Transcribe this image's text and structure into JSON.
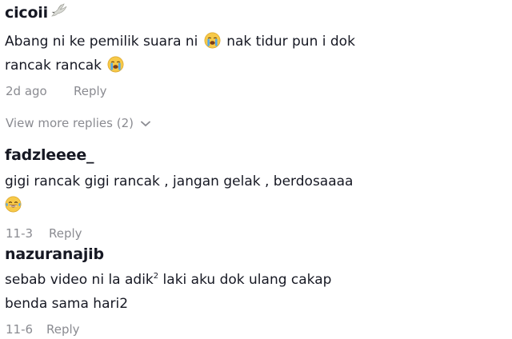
{
  "comments": [
    {
      "username": "cicoii",
      "text_line1_a": "Abang ni ke pemilik suara ni",
      "text_line1_b": "nak tidur pun i dok",
      "text_line2": "rancak rancak",
      "date": "2d ago",
      "reply_label": "Reply",
      "view_more_label": "View more replies (2)"
    },
    {
      "username": "fadzleeee_",
      "text_line1": "gigi rancak gigi rancak , jangan gelak , berdosaaaa",
      "date": "11-3",
      "reply_label": "Reply"
    },
    {
      "username": "nazuranajib",
      "text_line1_a": "sebab video ni la adik",
      "text_line1_sup": "2",
      "text_line1_b": " laki aku dok ulang cakap",
      "text_line2": "benda sama hari2",
      "date": "11-6",
      "reply_label": "Reply"
    }
  ],
  "colors": {
    "text": "#161823",
    "muted": "#8a8b91",
    "emoji_face": "#f7c948"
  },
  "icons": {
    "dove": "dove-icon",
    "crying": "loudly-crying-face-icon",
    "laughing": "tears-of-joy-icon",
    "chevron": "chevron-down-icon"
  }
}
